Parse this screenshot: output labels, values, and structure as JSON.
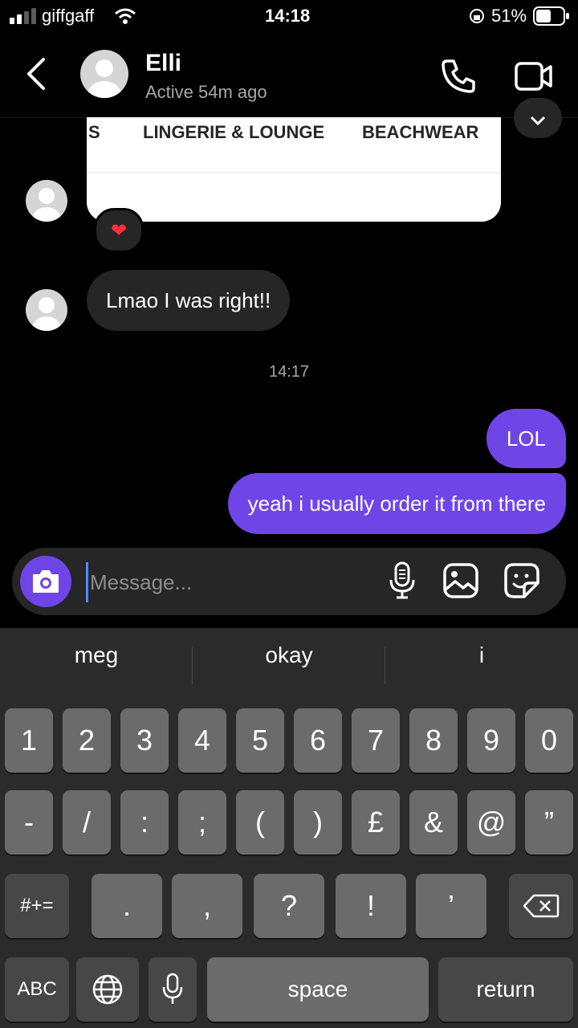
{
  "status_bar": {
    "carrier": "giffgaff",
    "time": "14:18",
    "battery": "51%"
  },
  "header": {
    "name": "Elli",
    "status": "Active 54m ago"
  },
  "shared_card": {
    "nav_items": [
      "S",
      "LINGERIE & LOUNGE",
      "BEACHWEAR"
    ]
  },
  "reaction": {
    "emoji": "❤"
  },
  "messages": {
    "incoming_1": "Lmao I was right!!",
    "timestamp": "14:17",
    "outgoing_1": "LOL",
    "outgoing_2": "yeah i usually order it from there"
  },
  "composer": {
    "placeholder": "Message..."
  },
  "keyboard": {
    "suggestions": [
      "meg",
      "okay",
      "i"
    ],
    "row1": [
      "1",
      "2",
      "3",
      "4",
      "5",
      "6",
      "7",
      "8",
      "9",
      "0"
    ],
    "row2": [
      "-",
      "/",
      ":",
      ";",
      "(",
      ")",
      "£",
      "&",
      "@",
      "”"
    ],
    "row3": [
      ".",
      ",",
      "?",
      "!",
      "’"
    ],
    "symbols_label": "#+=",
    "abc_label": "ABC",
    "space_label": "space",
    "return_label": "return"
  },
  "colors": {
    "accent": "#6f45e8",
    "bubble_incoming": "#262626",
    "key": "#6b6b6b",
    "key_dark": "#474747"
  }
}
